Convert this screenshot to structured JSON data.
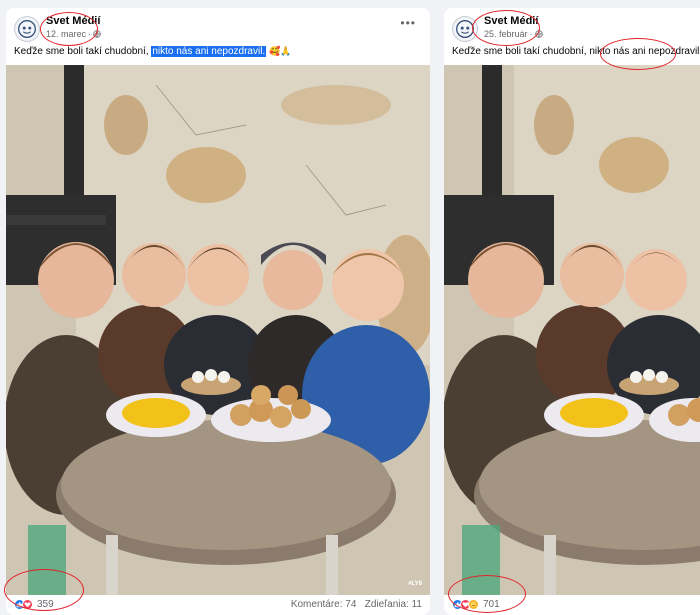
{
  "posts": [
    {
      "page_name": "Svet Médií",
      "date": "12. marec",
      "sep": " · ",
      "caption_plain": "Keďže sme boli takí chudobní, ",
      "caption_highlight": "nikto nás ani nepozdravil.",
      "caption_emoji": "🥰🙏",
      "more_icon": "more-options-icon",
      "photo_watermark": "#LY8",
      "reaction_icons": [
        "like",
        "love"
      ],
      "reaction_count": "359",
      "comments": "Komentáre: 74",
      "shares": "Zdieľania: 11"
    },
    {
      "page_name": "Svet Médií",
      "date": "25. február",
      "sep": " · ",
      "caption_plain": "Keďže sme boli takí chudobní, nikto nás ani nepozdravil.",
      "caption_emoji": "🥰🙏❤️",
      "reaction_icons": [
        "like",
        "love",
        "care"
      ],
      "reaction_count": "701"
    }
  ],
  "colors": {
    "facebook_blue": "#1877f2",
    "love_red": "#f33e58",
    "highlight": "#1b6ff0",
    "annotation_red": "#e0242a"
  }
}
